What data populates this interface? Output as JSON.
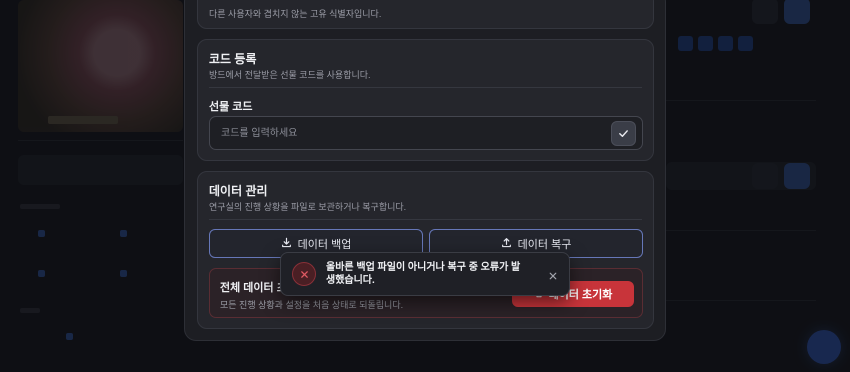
{
  "profile_card": {
    "description": "다른 사용자와 겹치지 않는 고유 식별자입니다."
  },
  "code_card": {
    "title": "코드 등록",
    "description": "방드에서 전달받은 선물 코드를 사용합니다.",
    "field_label": "선물 코드",
    "input_placeholder": "코드를 입력하세요",
    "input_value": "",
    "submit_icon": "check-icon"
  },
  "data_card": {
    "title": "데이터 관리",
    "description": "연구실의 진행 상황을 파일로 보관하거나 복구합니다.",
    "backup_label": "데이터 백업",
    "backup_icon": "download-icon",
    "restore_label": "데이터 복구",
    "restore_icon": "upload-icon",
    "reset": {
      "title": "전체 데이터 초기화",
      "description": "모든 진행 상황과 설정을 처음 상태로 되돌립니다.",
      "button_label": "데이터 초기화",
      "button_icon": "trash-icon"
    }
  },
  "toast": {
    "message": "올바른 백업 파일이 아니거나 복구 중 오류가 발생했습니다.",
    "icon": "error-x-icon",
    "close_icon": "close-icon"
  },
  "colors": {
    "accent": "#6677b8",
    "danger": "#c8343a",
    "surface": "#25262c",
    "background": "#1d1e23"
  }
}
